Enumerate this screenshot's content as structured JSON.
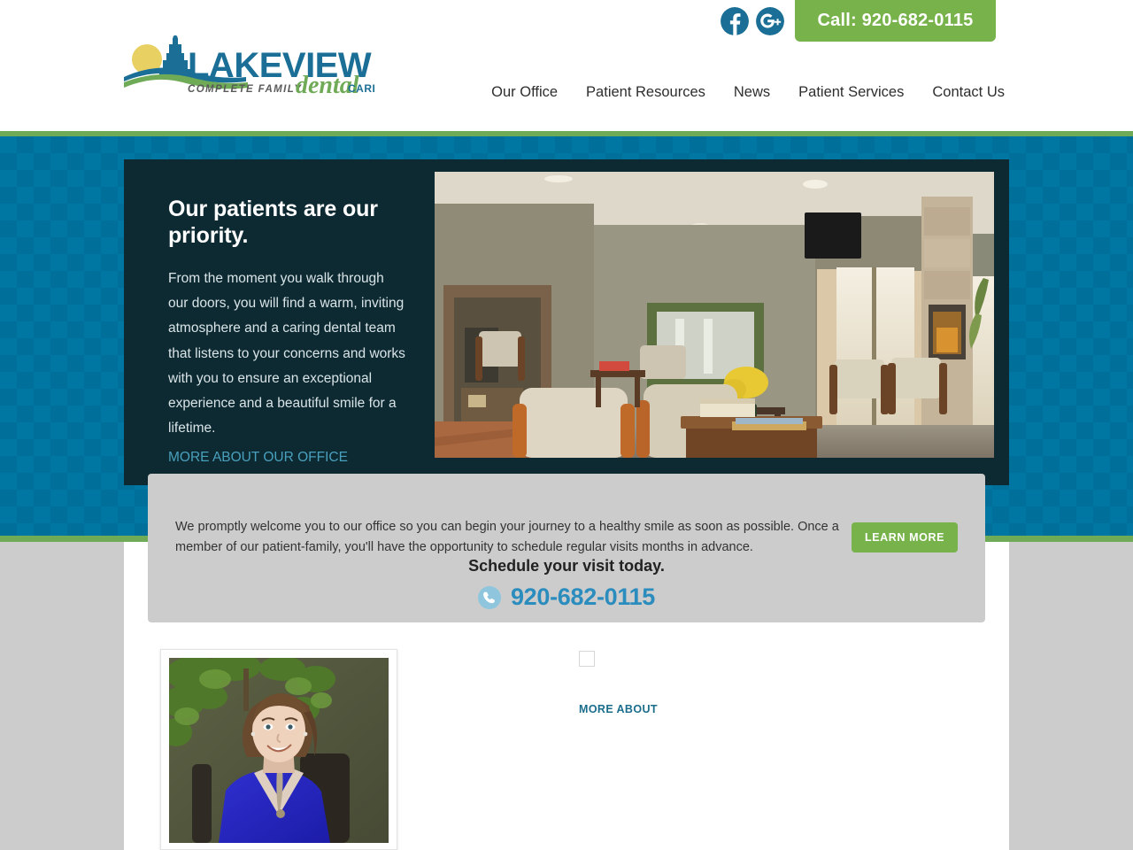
{
  "site": {
    "logo": {
      "brand_line1": "LAKEVIEW",
      "tagline": "COMPLETE FAMILY",
      "script_word": "dental",
      "care_word": "CARE",
      "alt": "Lakeview Complete Family Dental Care"
    },
    "colors": {
      "teal_band": "#0076a3",
      "green_accent": "#6faa56",
      "dark_panel": "#0d2a33",
      "callout_gray": "#cccccc",
      "link_blue": "#49a0bd",
      "phone_blue": "#2b8cbe",
      "button_green": "#77b24a"
    }
  },
  "header": {
    "social": [
      {
        "name": "facebook-icon",
        "label": "Facebook"
      },
      {
        "name": "google-plus-icon",
        "label": "Google Plus"
      }
    ],
    "call_button": "Call: 920-682-0115",
    "nav": [
      {
        "label": "Our Office"
      },
      {
        "label": "Patient Resources"
      },
      {
        "label": "News"
      },
      {
        "label": "Patient Services"
      },
      {
        "label": "Contact Us"
      }
    ]
  },
  "hero": {
    "heading": "Our patients are our priority.",
    "paragraph": "From the moment you walk through our doors, you will find a warm, inviting atmosphere and a caring dental team that listens to your concerns and works with you to ensure an exceptional experience and a beautiful smile for a lifetime.",
    "link": "MORE ABOUT OUR OFFICE",
    "photo_alt": "Dental office waiting room with fireplace, chairs and large windows"
  },
  "callout": {
    "paragraph": "We promptly welcome you to our office so you can begin your journey to a healthy smile as soon as possible. Once a member of our patient-family, you'll have the opportunity to schedule regular visits months in advance.",
    "schedule_heading": "Schedule your visit today.",
    "phone": "920-682-0115",
    "phone_icon": "phone-icon",
    "learn_more": "LEARN MORE"
  },
  "lower": {
    "staff_photo_alt": "Smiling staff member in a blue blouse",
    "broken_image_alt": "",
    "more_about_link": "MORE ABOUT"
  }
}
